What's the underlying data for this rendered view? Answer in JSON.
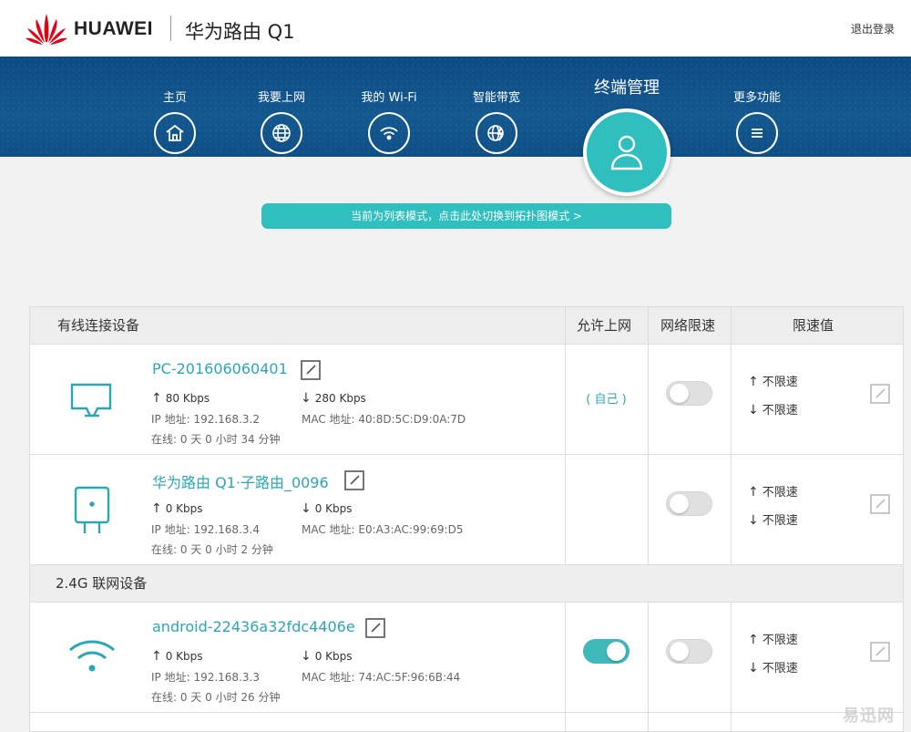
{
  "header": {
    "brand": "HUAWEI",
    "product": "华为路由 Q1",
    "logout": "退出登录"
  },
  "nav": {
    "items": [
      {
        "label": "主页",
        "icon": "home-icon"
      },
      {
        "label": "我要上网",
        "icon": "globe-icon"
      },
      {
        "label": "我的 Wi-Fi",
        "icon": "wifi-icon"
      },
      {
        "label": "智能带宽",
        "icon": "bandwidth-icon"
      },
      {
        "label": "终端管理",
        "icon": "user-icon",
        "active": true
      },
      {
        "label": "更多功能",
        "icon": "menu-icon"
      }
    ]
  },
  "mode_banner": "当前为列表模式，点击此处切换到拓扑图模式 >",
  "table": {
    "headers": {
      "wired": "有线连接设备",
      "allow": "允许上网",
      "limit": "网络限速",
      "limit_value": "限速值"
    },
    "section_24g": "2.4G 联网设备",
    "rows": [
      {
        "name": "PC-201606060401",
        "up": "80 Kbps",
        "down": "280 Kbps",
        "ip": "IP 地址: 192.168.3.2",
        "mac": "MAC 地址: 40:8D:5C:D9:0A:7D",
        "online": "在线:  0 天 0 小时 34 分钟",
        "self": "( 自己 )",
        "limit_up": "不限速",
        "limit_down": "不限速"
      },
      {
        "name": "华为路由 Q1·子路由_0096",
        "up": "0 Kbps",
        "down": "0 Kbps",
        "ip": "IP 地址: 192.168.3.4",
        "mac": "MAC 地址: E0:A3:AC:99:69:D5",
        "online": "在线:  0 天 0 小时 2 分钟",
        "limit_up": "不限速",
        "limit_down": "不限速"
      },
      {
        "name": "android-22436a32fdc4406e",
        "up": "0 Kbps",
        "down": "0 Kbps",
        "ip": "IP 地址: 192.168.3.3",
        "mac": "MAC 地址: 74:AC:5F:96:6B:44",
        "online": "在线:  0 天 0 小时 26 分钟",
        "limit_up": "不限速",
        "limit_down": "不限速"
      }
    ]
  },
  "watermark": "易迅网",
  "colors": {
    "accent": "#2fbfbf",
    "nav_bg": "#0e4b84",
    "link": "#2aa7b6"
  }
}
